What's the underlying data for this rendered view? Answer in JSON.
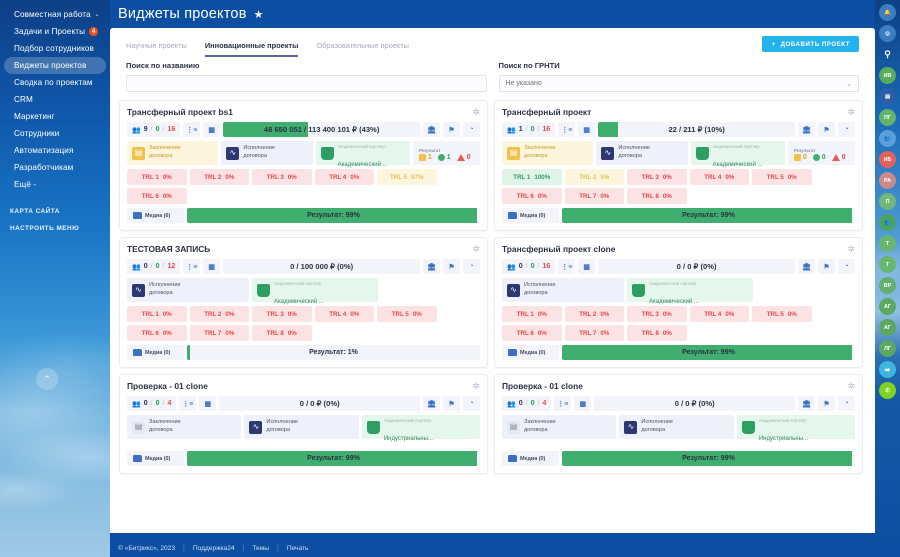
{
  "left_nav": {
    "items": [
      {
        "label": "Совместная работа",
        "chevron": "⌄",
        "active": false,
        "badge": null
      },
      {
        "label": "Задачи и Проекты",
        "chevron": null,
        "active": false,
        "badge": "4"
      },
      {
        "label": "Подбор сотрудников",
        "chevron": null,
        "active": false,
        "badge": null
      },
      {
        "label": "Виджеты проектов",
        "chevron": null,
        "active": true,
        "badge": null
      },
      {
        "label": "Сводка по проектам",
        "chevron": null,
        "active": false,
        "badge": null
      },
      {
        "label": "CRM",
        "chevron": null,
        "active": false,
        "badge": null
      },
      {
        "label": "Маркетинг",
        "chevron": null,
        "active": false,
        "badge": null
      },
      {
        "label": "Сотрудники",
        "chevron": null,
        "active": false,
        "badge": null
      },
      {
        "label": "Автоматизация",
        "chevron": null,
        "active": false,
        "badge": null
      },
      {
        "label": "Разработчикам",
        "chevron": null,
        "active": false,
        "badge": null
      },
      {
        "label": "Ещё -",
        "chevron": null,
        "active": false,
        "badge": null
      }
    ],
    "sub_links": [
      "КАРТА САЙТА",
      "НАСТРОИТЬ МЕНЮ"
    ],
    "scroll_top_icon": "⌃"
  },
  "header": {
    "title": "Виджеты проектов",
    "star_icon": "★"
  },
  "tabs": [
    {
      "label": "Научные проекты",
      "active": false
    },
    {
      "label": "Инновационные проекты",
      "active": true
    },
    {
      "label": "Образовательные проекты",
      "active": false
    }
  ],
  "filters": {
    "name": {
      "label": "Поиск по названию",
      "value": "",
      "placeholder": ""
    },
    "grnti": {
      "label": "Поиск по ГРНТИ",
      "value": "Не указано",
      "chevron": "⌄"
    }
  },
  "add_button": {
    "label": "ДОБАВИТЬ ПРОЕКТ",
    "plus": "+"
  },
  "cards": [
    {
      "title": "Трансферный проект bs1",
      "gear": "✲",
      "people": {
        "a": "9",
        "b": "0",
        "c": "16"
      },
      "money_text": "48 650 051 / 113 400 101 ₽ (43%)",
      "money_fill_pct": 43,
      "stages": [
        {
          "type": "yellow",
          "line1": "Заключение",
          "line2": "договора"
        },
        {
          "type": "blue",
          "line1": "Исполнение",
          "line2": "договора"
        },
        {
          "type": "green",
          "sub": "Академический партнёр:",
          "main": "Академический ..."
        }
      ],
      "result": {
        "label": "Результат",
        "yellow": "1",
        "green": "1",
        "red": "0"
      },
      "trl": [
        {
          "n": "TRL 1",
          "v": "0%",
          "c": "red"
        },
        {
          "n": "TRL 2",
          "v": "0%",
          "c": "red"
        },
        {
          "n": "TRL 3",
          "v": "0%",
          "c": "red"
        },
        {
          "n": "TRL 4",
          "v": "0%",
          "c": "red"
        },
        {
          "n": "TRL 5",
          "v": "67%",
          "c": "yellow"
        },
        {
          "n": "TRL 6",
          "v": "0%",
          "c": "red"
        }
      ],
      "media": "Медиа (6)",
      "progress_text": "Результат: 99%",
      "progress_pct": 99
    },
    {
      "title": "Трансферный проект",
      "gear": "✲",
      "people": {
        "a": "1",
        "b": "0",
        "c": "16"
      },
      "money_text": "22 / 211 ₽ (10%)",
      "money_fill_pct": 10,
      "stages": [
        {
          "type": "yellow",
          "line1": "Заключение",
          "line2": "договора"
        },
        {
          "type": "blue",
          "line1": "Исполнение",
          "line2": "договора"
        },
        {
          "type": "green",
          "sub": "Академический партнёр:",
          "main": "Академический ..."
        }
      ],
      "result": {
        "label": "Результат",
        "yellow": "0",
        "green": "0",
        "red": "0"
      },
      "trl": [
        {
          "n": "TRL 1",
          "v": "100%",
          "c": "green"
        },
        {
          "n": "TRL 2",
          "v": "5%",
          "c": "yellow"
        },
        {
          "n": "TRL 3",
          "v": "0%",
          "c": "red"
        },
        {
          "n": "TRL 4",
          "v": "0%",
          "c": "red"
        },
        {
          "n": "TRL 5",
          "v": "0%",
          "c": "red"
        },
        {
          "n": "TRL 6",
          "v": "0%",
          "c": "red"
        },
        {
          "n": "TRL 7",
          "v": "0%",
          "c": "red"
        },
        {
          "n": "TRL 8",
          "v": "0%",
          "c": "red"
        }
      ],
      "media": "Медиа (0)",
      "progress_text": "Результат: 99%",
      "progress_pct": 99
    },
    {
      "title": "ТЕСТОВАЯ ЗАПИСЬ",
      "gear": "✲",
      "people": {
        "a": "0",
        "b": "0",
        "c": "12"
      },
      "money_text": "0 / 100 000 ₽ (0%)",
      "money_fill_pct": 0,
      "stages": [
        {
          "type": "blue",
          "line1": "Исполнение",
          "line2": "договора"
        },
        {
          "type": "green",
          "sub": "Академический партнёр:",
          "main": "Академический ..."
        }
      ],
      "result": null,
      "trl": [
        {
          "n": "TRL 1",
          "v": "0%",
          "c": "red"
        },
        {
          "n": "TRL 2",
          "v": "0%",
          "c": "red"
        },
        {
          "n": "TRL 3",
          "v": "0%",
          "c": "red"
        },
        {
          "n": "TRL 4",
          "v": "0%",
          "c": "red"
        },
        {
          "n": "TRL 5",
          "v": "0%",
          "c": "red"
        },
        {
          "n": "TRL 6",
          "v": "0%",
          "c": "red"
        },
        {
          "n": "TRL 7",
          "v": "0%",
          "c": "red"
        },
        {
          "n": "TRL 8",
          "v": "0%",
          "c": "red"
        }
      ],
      "media": "Медиа (0)",
      "progress_text": "Результат: 1%",
      "progress_pct": 1
    },
    {
      "title": "Трансферный проект clone",
      "gear": "✲",
      "people": {
        "a": "0",
        "b": "0",
        "c": "16"
      },
      "money_text": "0 / 0 ₽ (0%)",
      "money_fill_pct": 0,
      "stages": [
        {
          "type": "blue",
          "line1": "Исполнение",
          "line2": "договора"
        },
        {
          "type": "green",
          "sub": "Академический партнёр:",
          "main": "Академический ..."
        }
      ],
      "result": null,
      "trl": [
        {
          "n": "TRL 1",
          "v": "0%",
          "c": "red"
        },
        {
          "n": "TRL 2",
          "v": "0%",
          "c": "red"
        },
        {
          "n": "TRL 3",
          "v": "0%",
          "c": "red"
        },
        {
          "n": "TRL 4",
          "v": "0%",
          "c": "red"
        },
        {
          "n": "TRL 5",
          "v": "0%",
          "c": "red"
        },
        {
          "n": "TRL 6",
          "v": "0%",
          "c": "red"
        },
        {
          "n": "TRL 7",
          "v": "0%",
          "c": "red"
        },
        {
          "n": "TRL 8",
          "v": "0%",
          "c": "red"
        }
      ],
      "media": "Медиа (0)",
      "progress_text": "Результат: 99%",
      "progress_pct": 99
    },
    {
      "title": "Проверка - 01 clone",
      "gear": "✲",
      "people": {
        "a": "0",
        "b": "0",
        "c": "4"
      },
      "money_text": "0 / 0 ₽ (0%)",
      "money_fill_pct": 0,
      "stages": [
        {
          "type": "blue-gray",
          "line1": "Заключение",
          "line2": "договора"
        },
        {
          "type": "blue",
          "line1": "Исполнение",
          "line2": "договора"
        },
        {
          "type": "green",
          "sub": "Академический партнёр:",
          "main": "Индустриальны..."
        }
      ],
      "result": null,
      "trl": [],
      "media": "Медиа (0)",
      "progress_text": "Результат: 99%",
      "progress_pct": 99
    },
    {
      "title": "Проверка - 01 clone",
      "gear": "✲",
      "people": {
        "a": "0",
        "b": "0",
        "c": "4"
      },
      "money_text": "0 / 0 ₽ (0%)",
      "money_fill_pct": 0,
      "stages": [
        {
          "type": "blue-gray",
          "line1": "Заключение",
          "line2": "договора"
        },
        {
          "type": "blue",
          "line1": "Исполнение",
          "line2": "договора"
        },
        {
          "type": "green",
          "sub": "Академический партнёр:",
          "main": "Индустриальны..."
        }
      ],
      "result": null,
      "trl": [],
      "media": "Медиа (0)",
      "progress_text": "Результат: 99%",
      "progress_pct": 99
    }
  ],
  "footer": {
    "copyright": "© «Битрикс», 2023",
    "links": [
      "Поддержка24",
      "Темы",
      "Печать"
    ],
    "divider": "|"
  },
  "right_bar": {
    "icons": [
      {
        "label": "🔔",
        "bg": "#3c7cc0",
        "kind": "glyph",
        "name": "bell-icon"
      },
      {
        "label": "◎",
        "bg": "#3c7cc0",
        "kind": "glyph",
        "name": "clock-icon"
      },
      {
        "label": "⚲",
        "bg": "transparent",
        "kind": "plain",
        "name": "search-icon"
      },
      {
        "label": "ИВ",
        "bg": "#5aab5e",
        "kind": "avatar",
        "name": "avatar-iv"
      },
      {
        "label": "▤",
        "bg": "#2c5fa8",
        "kind": "glyph",
        "name": "chat-icon"
      },
      {
        "label": "ПГ",
        "bg": "#64b36a",
        "kind": "avatar",
        "name": "avatar-pg"
      },
      {
        "label": "👥",
        "bg": "#5b9fd4",
        "kind": "glyph",
        "name": "group-icon"
      },
      {
        "label": "ИБ",
        "bg": "#e2625a",
        "kind": "avatar",
        "name": "avatar-ib"
      },
      {
        "label": "РА",
        "bg": "#c98a8a",
        "kind": "avatar",
        "name": "avatar-ra"
      },
      {
        "label": "П",
        "bg": "#6fb87a",
        "kind": "avatar",
        "name": "avatar-p"
      },
      {
        "label": "👥",
        "bg": "#4aa35e",
        "kind": "glyph",
        "name": "group2-icon"
      },
      {
        "label": "Т",
        "bg": "#68b76f",
        "kind": "avatar",
        "name": "avatar-t1"
      },
      {
        "label": "Т",
        "bg": "#68b76f",
        "kind": "avatar",
        "name": "avatar-t2"
      },
      {
        "label": "ВР",
        "bg": "#62b06b",
        "kind": "avatar",
        "name": "avatar-vr"
      },
      {
        "label": "АГ",
        "bg": "#5aa862",
        "kind": "avatar",
        "name": "avatar-ag"
      },
      {
        "label": "АГ",
        "bg": "#5aa862",
        "kind": "avatar",
        "name": "avatar-ag2"
      },
      {
        "label": "ЛГ",
        "bg": "#5aa862",
        "kind": "avatar",
        "name": "avatar-lg"
      },
      {
        "label": "⮕",
        "bg": "#3cb8e0",
        "kind": "glyph",
        "name": "logout-icon"
      },
      {
        "label": "✆",
        "bg": "#7ed321",
        "kind": "glyph",
        "name": "phone-icon"
      }
    ]
  }
}
